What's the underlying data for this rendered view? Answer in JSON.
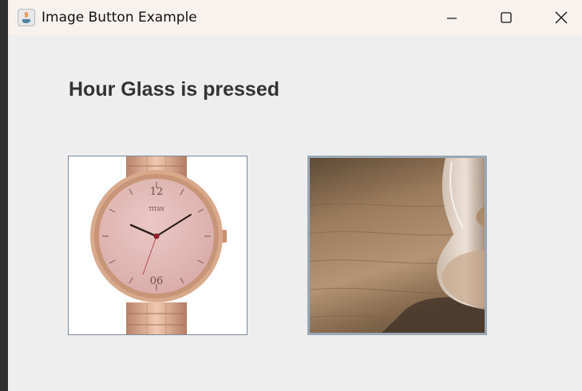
{
  "window": {
    "title": "Image Button Example",
    "controls": [
      "minimize",
      "maximize",
      "close"
    ]
  },
  "status": {
    "text": "Hour Glass is pressed"
  },
  "buttons": [
    {
      "name": "watch",
      "icon": "watch-image"
    },
    {
      "name": "hourglass",
      "icon": "hourglass-image",
      "pressed": true
    }
  ],
  "watch_face": {
    "brand": "TITAN",
    "numeral_top": "12",
    "numeral_bottom": "06"
  },
  "colors": {
    "window_bg": "#eeeeee",
    "titlebar_bg": "#f7f2ee",
    "label_color": "#333333"
  }
}
